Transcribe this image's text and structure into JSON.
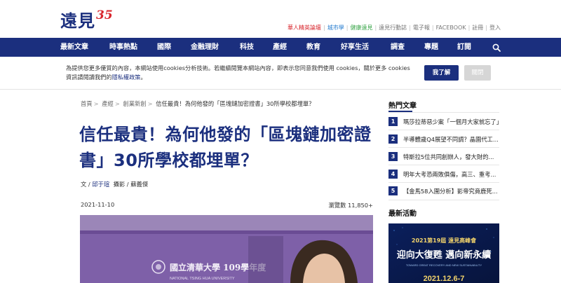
{
  "header": {
    "logo_text": "遠見",
    "logo_number": "35",
    "top_links": [
      {
        "label": "華人精英論壇",
        "color": "#d8262d"
      },
      {
        "label": "城市學",
        "color": "#2a7fd0"
      },
      {
        "label": "健康遠見",
        "color": "#3aa64a"
      },
      {
        "label": "遠見行動誌",
        "color": "#777777"
      },
      {
        "label": "電子報",
        "color": "#777777"
      },
      {
        "label": "FACEBOOK",
        "color": "#777777"
      },
      {
        "label": "註冊",
        "color": "#777777"
      },
      {
        "label": "登入",
        "color": "#777777"
      }
    ]
  },
  "nav": {
    "items": [
      "最新文章",
      "時事熱點",
      "國際",
      "金融理財",
      "科技",
      "產經",
      "教育",
      "好享生活",
      "調查",
      "專題",
      "訂閱"
    ],
    "search_icon": "search-icon"
  },
  "cookie": {
    "text_before_link": "為提供您更多優質的內容，本網站使用cookies分析技術。若繼續閱覽本網站內容，即表示您同意我們使用 cookies，關於更多 cookies 資訊請閱讀我們的",
    "link_text": "隱私權政策",
    "text_after_link": "。",
    "accept_label": "我了解",
    "close_label": "關閉"
  },
  "breadcrumb": {
    "items": [
      "首頁",
      "產經",
      "創業新創"
    ],
    "current": "信任最貴！為何他發的「區塊鏈加密證書」30所學校都埋單？",
    "separator": ">"
  },
  "article": {
    "title": "信任最貴！為何他發的「區塊鏈加密證書」30所學校都埋單？",
    "byline_prefix": "文 / ",
    "author": "邱于瑄",
    "photo_credit": "攝影 / 蘇義傑",
    "date": "2021-11-10",
    "views_label": "瀏覽數",
    "views": "11,850+",
    "hero_banner_text": "國立清華大學 109學年度",
    "hero_banner_sub": "NATIONAL TSING HUA UNIVERSITY"
  },
  "sidebar": {
    "hot_heading": "熱門文章",
    "hot_items": [
      {
        "rank": "1",
        "title": "瑪莎拉蒂惡少案「一個月大家就忘了」"
      },
      {
        "rank": "2",
        "title": "半導體歲Q4展望不同調？晶園代工..."
      },
      {
        "rank": "3",
        "title": "特斯拉5位共同創辦人，發大財的..."
      },
      {
        "rank": "4",
        "title": "明年大考恐兩敗俱傷，高三、重考..."
      },
      {
        "rank": "5",
        "title": "【金馬58入圍分析】影帝究竟鹿死..."
      }
    ],
    "event_heading": "最新活動",
    "event": {
      "top": "2021第19屆 遠見高峰會",
      "main": "迎向大復甦 邁向新永續",
      "sub": "TOWARD GREAT RECOVERY AND NEW SUSTAINABILITY",
      "date": "2021.12.6-7"
    }
  }
}
